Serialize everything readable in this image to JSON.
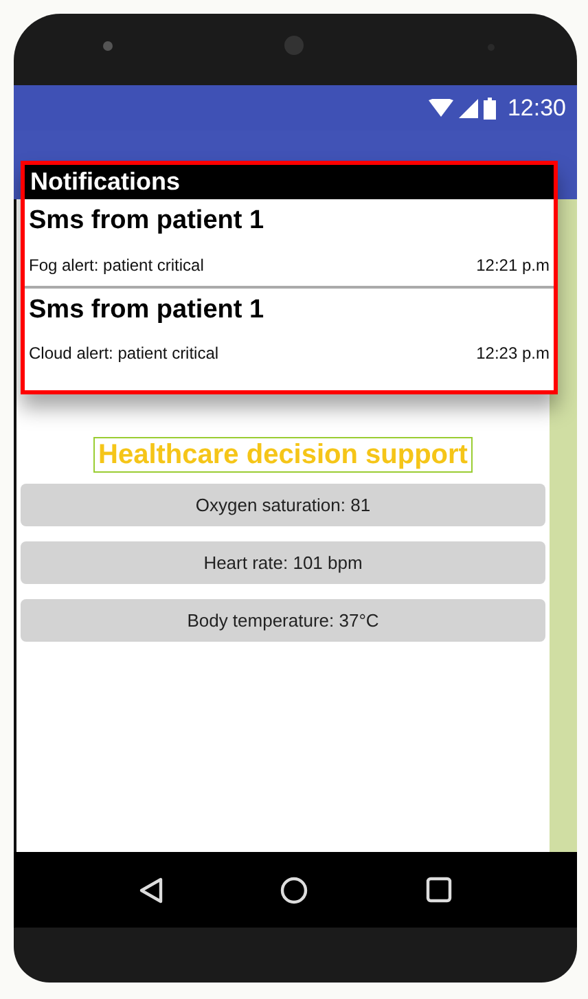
{
  "status_bar": {
    "time": "12:30"
  },
  "notifications": {
    "title": "Notifications",
    "items": [
      {
        "title": "Sms from patient 1",
        "message": "Fog alert: patient critical",
        "time": "12:21 p.m"
      },
      {
        "title": "Sms from patient 1",
        "message": "Cloud alert: patient critical",
        "time": "12:23 p.m"
      }
    ]
  },
  "app": {
    "title": "Healthcare decision support",
    "readings": [
      {
        "label": "Oxygen saturation: 81"
      },
      {
        "label": "Heart rate: 101 bpm"
      },
      {
        "label": "Body temperature: 37°C"
      }
    ]
  }
}
